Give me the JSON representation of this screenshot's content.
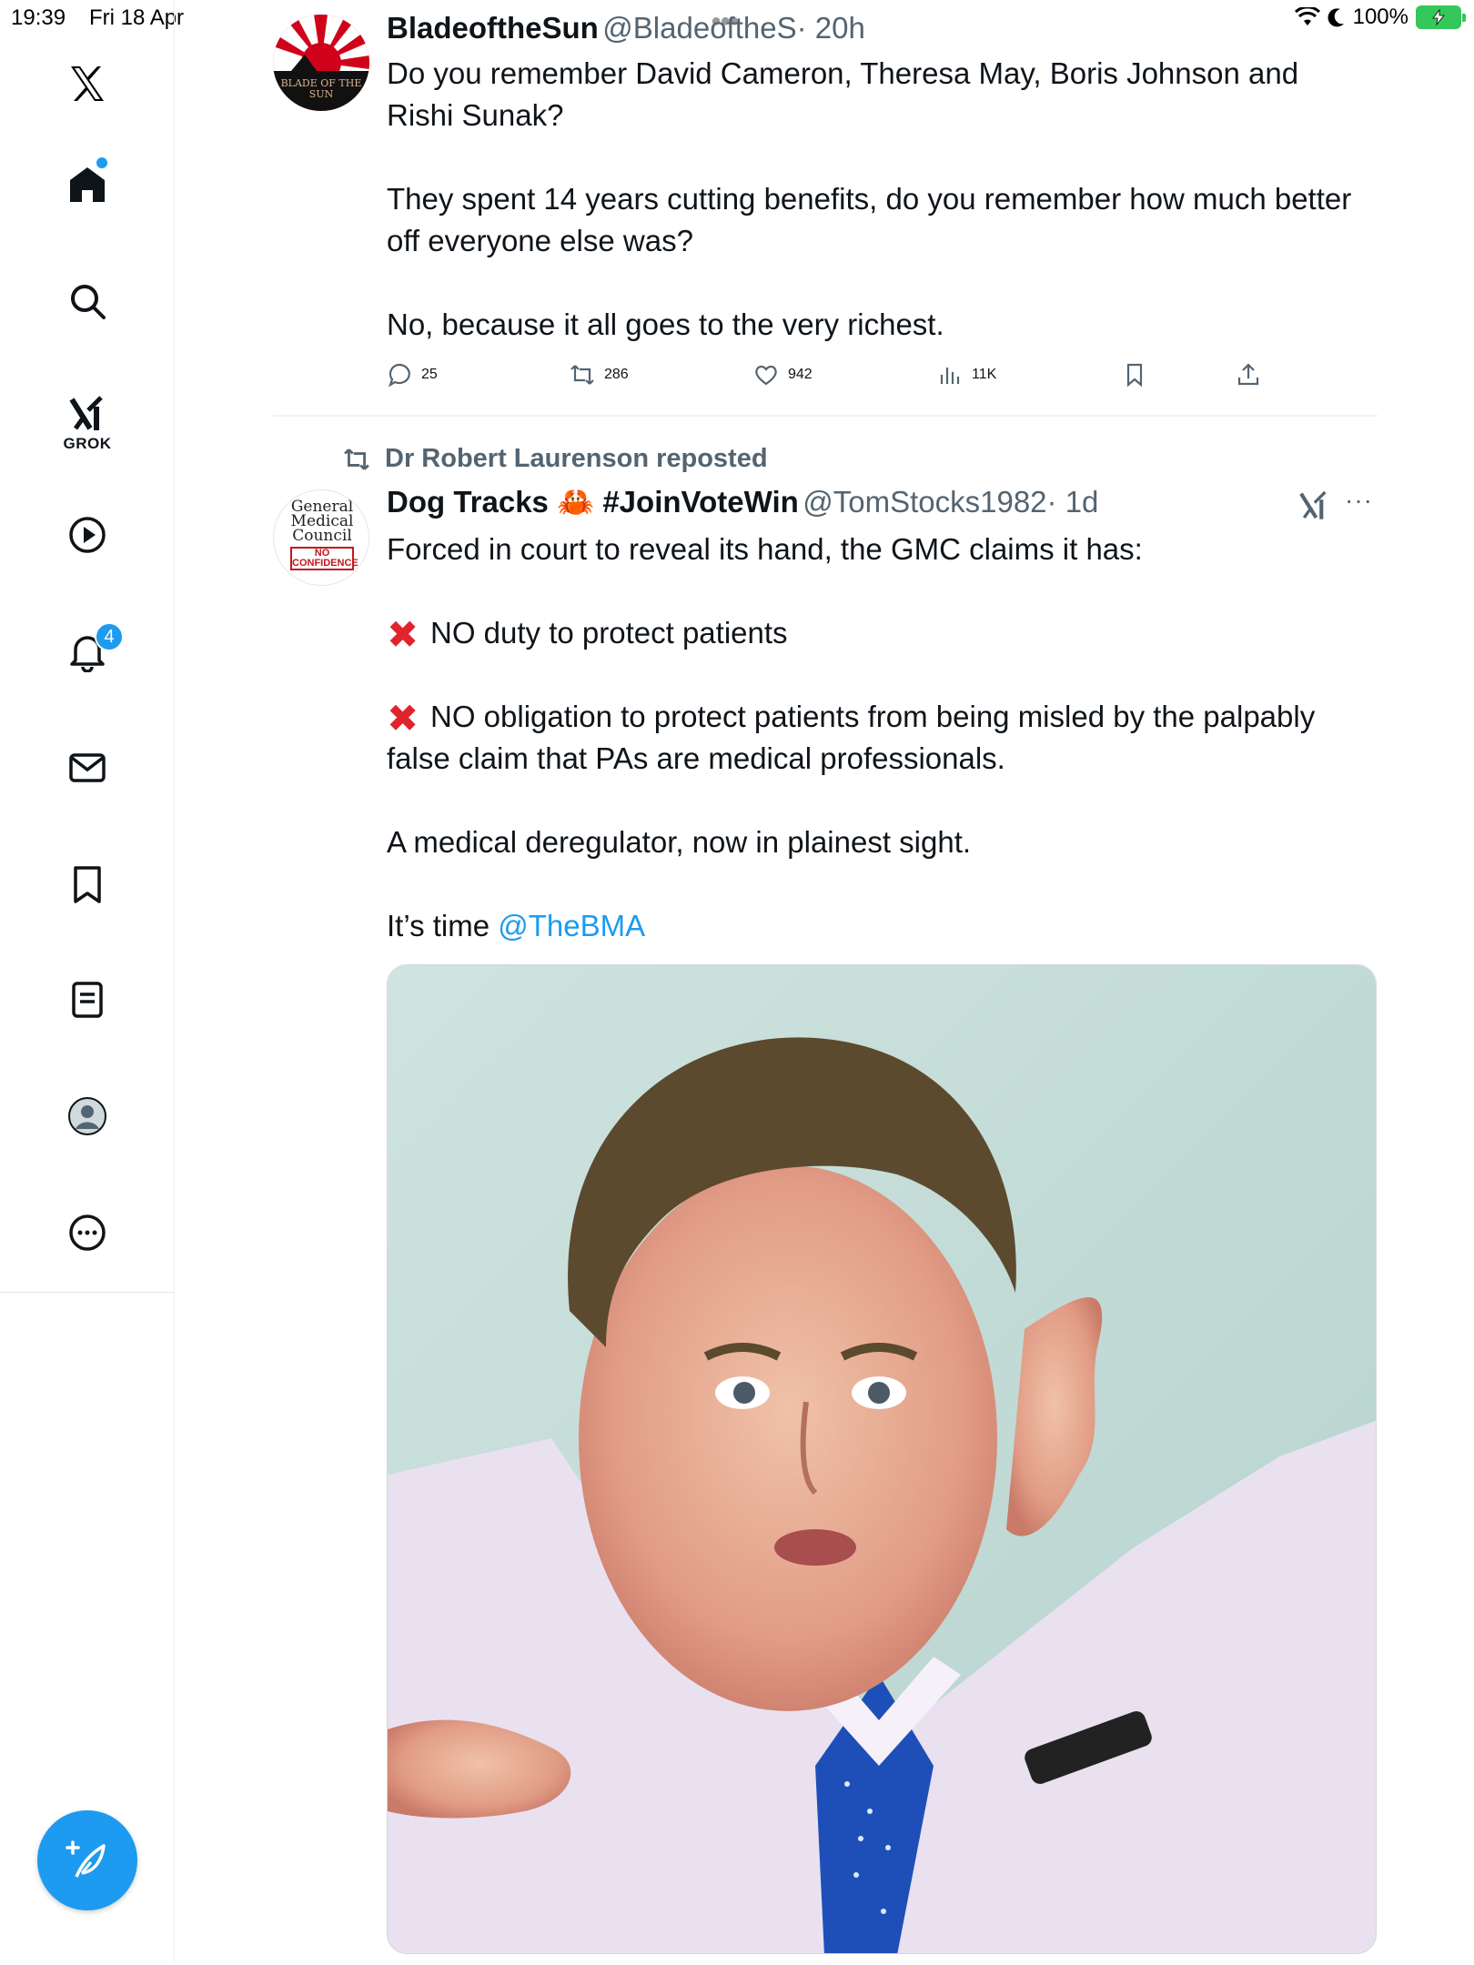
{
  "status_bar": {
    "time": "19:39",
    "date": "Fri 18 Apr",
    "battery": "100%"
  },
  "sidebar": {
    "grok_label": "GROK",
    "notification_count": "4"
  },
  "tweet1": {
    "display_name": "BladeoftheSun",
    "handle": "@BladeoftheS",
    "time": "· 20h",
    "avatar_text": "BLADE OF THE SUN",
    "text": "Do you remember David Cameron, Theresa May, Boris Johnson and Rishi Sunak?\n\nThey spent 14 years cutting benefits, do you remember how much better off everyone else was?\n\nNo, because it all goes to the very richest.",
    "replies": "25",
    "reposts": "286",
    "likes": "942",
    "views": "11K"
  },
  "tweet2": {
    "repost_label": "Dr Robert Laurenson reposted",
    "display_name": "Dog Tracks 🦀 #JoinVoteWin",
    "handle": "@TomStocks1982",
    "time": "· 1d",
    "avatar_lines": [
      "General",
      "Medical",
      "Council",
      "NO",
      "CONFIDENCE"
    ],
    "intro": "Forced in court to reveal its hand, the GMC claims it has:",
    "point1": "NO duty to protect patients",
    "point2": "NO obligation to protect patients from being misled by the palpably false claim that PAs are medical professionals.",
    "line3": "A medical deregulator, now in plainest sight.",
    "line4_prefix": "It’s time ",
    "mention": "@TheBMA",
    "x_mark": "✖",
    "more": "···"
  }
}
